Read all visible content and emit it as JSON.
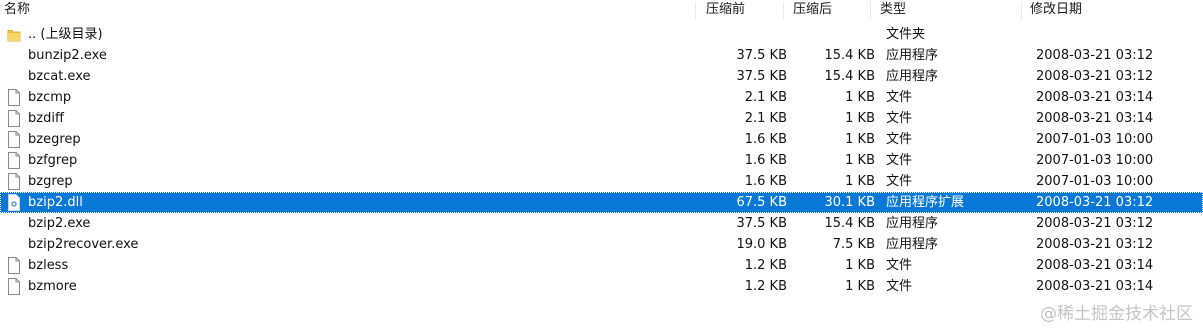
{
  "header": {
    "name": "名称",
    "size": "压缩前",
    "packed": "压缩后",
    "type": "类型",
    "modified": "修改日期"
  },
  "rows": [
    {
      "name": ".. (上级目录)",
      "size": "",
      "packed": "",
      "type": "文件夹",
      "modified": "",
      "icon": "folder-icon"
    },
    {
      "name": "bunzip2.exe",
      "size": "37.5 KB",
      "packed": "15.4 KB",
      "type": "应用程序",
      "modified": "2008-03-21 03:12",
      "icon": "none"
    },
    {
      "name": "bzcat.exe",
      "size": "37.5 KB",
      "packed": "15.4 KB",
      "type": "应用程序",
      "modified": "2008-03-21 03:12",
      "icon": "none"
    },
    {
      "name": "bzcmp",
      "size": "2.1 KB",
      "packed": "1 KB",
      "type": "文件",
      "modified": "2008-03-21 03:14",
      "icon": "file-icon"
    },
    {
      "name": "bzdiff",
      "size": "2.1 KB",
      "packed": "1 KB",
      "type": "文件",
      "modified": "2008-03-21 03:14",
      "icon": "file-icon"
    },
    {
      "name": "bzegrep",
      "size": "1.6 KB",
      "packed": "1 KB",
      "type": "文件",
      "modified": "2007-01-03 10:00",
      "icon": "file-icon"
    },
    {
      "name": "bzfgrep",
      "size": "1.6 KB",
      "packed": "1 KB",
      "type": "文件",
      "modified": "2007-01-03 10:00",
      "icon": "file-icon"
    },
    {
      "name": "bzgrep",
      "size": "1.6 KB",
      "packed": "1 KB",
      "type": "文件",
      "modified": "2007-01-03 10:00",
      "icon": "file-icon"
    },
    {
      "name": "bzip2.dll",
      "size": "67.5 KB",
      "packed": "30.1 KB",
      "type": "应用程序扩展",
      "modified": "2008-03-21 03:12",
      "icon": "dll-icon",
      "selected": true
    },
    {
      "name": "bzip2.exe",
      "size": "37.5 KB",
      "packed": "15.4 KB",
      "type": "应用程序",
      "modified": "2008-03-21 03:12",
      "icon": "none"
    },
    {
      "name": "bzip2recover.exe",
      "size": "19.0 KB",
      "packed": "7.5 KB",
      "type": "应用程序",
      "modified": "2008-03-21 03:12",
      "icon": "none"
    },
    {
      "name": "bzless",
      "size": "1.2 KB",
      "packed": "1 KB",
      "type": "文件",
      "modified": "2008-03-21 03:14",
      "icon": "file-icon"
    },
    {
      "name": "bzmore",
      "size": "1.2 KB",
      "packed": "1 KB",
      "type": "文件",
      "modified": "2008-03-21 03:14",
      "icon": "file-icon"
    }
  ],
  "watermark": "@稀土掘金技术社区",
  "colors": {
    "selection": "#0a78d7",
    "folder": "#f3c64a"
  }
}
